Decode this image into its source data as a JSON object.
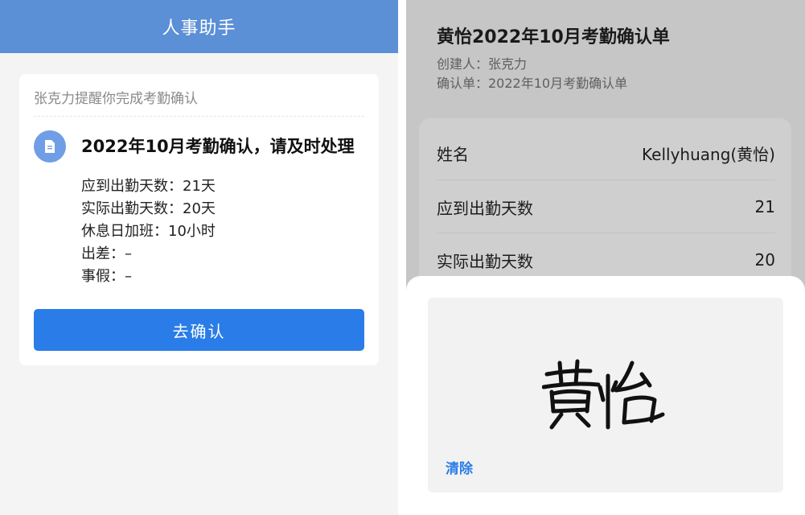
{
  "left": {
    "header_title": "人事助手",
    "card": {
      "from_text": "张克力提醒你完成考勤确认",
      "icon": "document-icon",
      "title": "2022年10月考勤确认，请及时处理",
      "details": [
        "应到出勤天数：21天",
        "实际出勤天数：20天",
        "休息日加班：10小时",
        "出差：–",
        "事假：–"
      ],
      "button_label": "去确认"
    }
  },
  "right": {
    "title": "黄怡2022年10月考勤确认单",
    "creator": "创建人：张克力",
    "form_name": "确认单：2022年10月考勤确认单",
    "rows": [
      {
        "label": "姓名",
        "value": "Kellyhuang(黄怡)"
      },
      {
        "label": "应到出勤天数",
        "value": "21"
      },
      {
        "label": "实际出勤天数",
        "value": "20"
      }
    ],
    "signature_text": "黄怡",
    "clear_label": "清除"
  },
  "colors": {
    "header_blue": "#5b8fd6",
    "button_blue": "#2a7de8",
    "overlay_gray": "#c6c6c6"
  }
}
